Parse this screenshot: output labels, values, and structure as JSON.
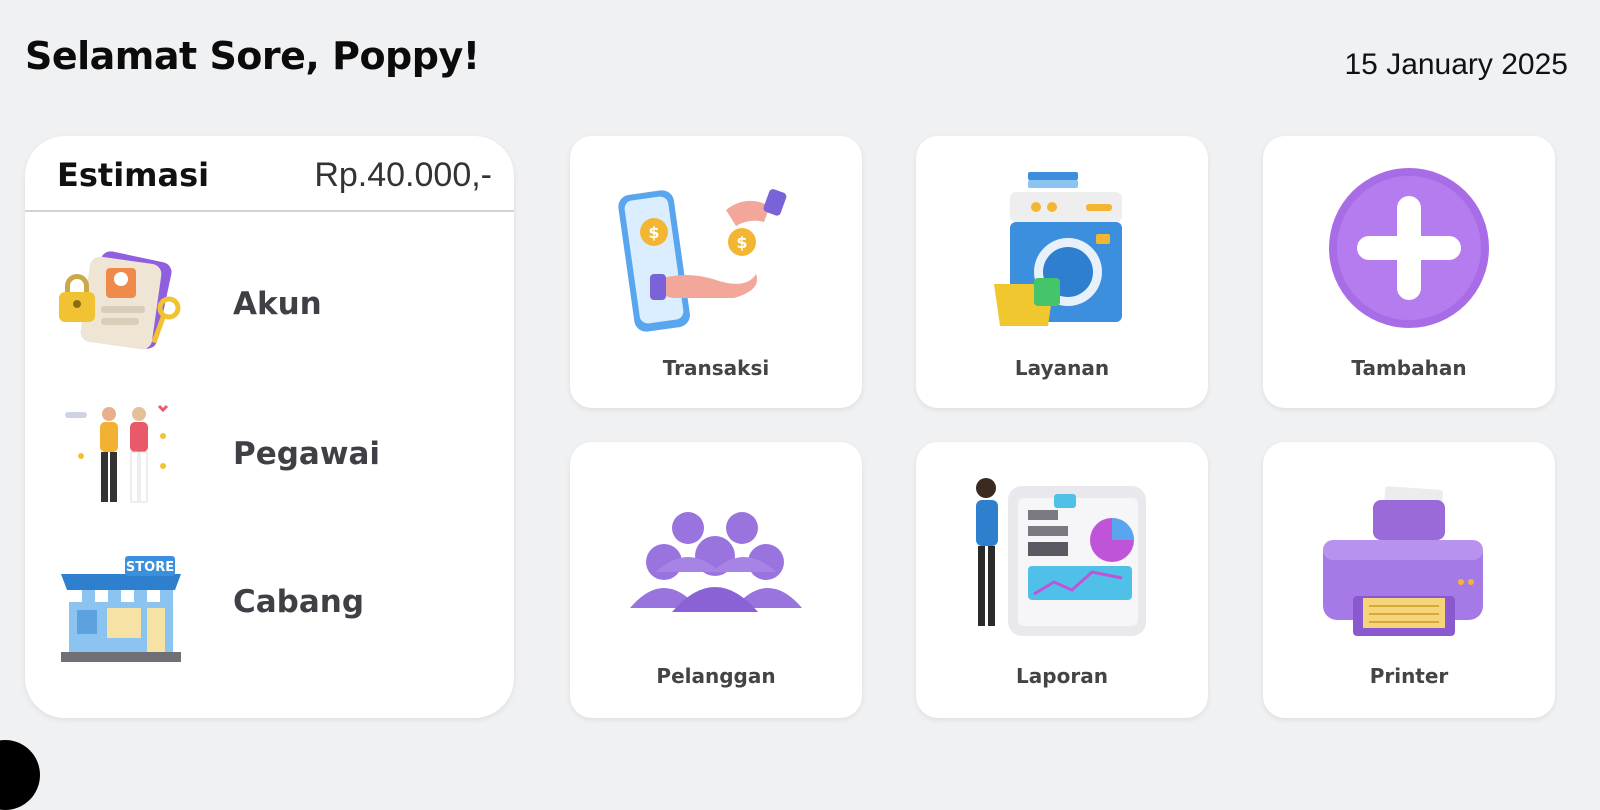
{
  "header": {
    "greeting": "Selamat Sore, Poppy!",
    "date": "15 January 2025"
  },
  "estimate": {
    "title": "Estimasi",
    "value": "Rp.40.000,-"
  },
  "side_menu": [
    {
      "label": "Akun",
      "icon": "account-lock-icon"
    },
    {
      "label": "Pegawai",
      "icon": "employees-icon"
    },
    {
      "label": "Cabang",
      "icon": "store-icon"
    }
  ],
  "tiles": [
    {
      "label": "Transaksi",
      "icon": "transaction-icon"
    },
    {
      "label": "Layanan",
      "icon": "laundry-machine-icon"
    },
    {
      "label": "Tambahan",
      "icon": "plus-icon"
    },
    {
      "label": "Pelanggan",
      "icon": "customers-icon"
    },
    {
      "label": "Laporan",
      "icon": "report-icon"
    },
    {
      "label": "Printer",
      "icon": "printer-icon"
    }
  ],
  "colors": {
    "background": "#f0f1f3",
    "card": "#ffffff",
    "accent_purple": "#9a6fe0",
    "text_dark": "#111111",
    "label_gray": "#444444"
  }
}
